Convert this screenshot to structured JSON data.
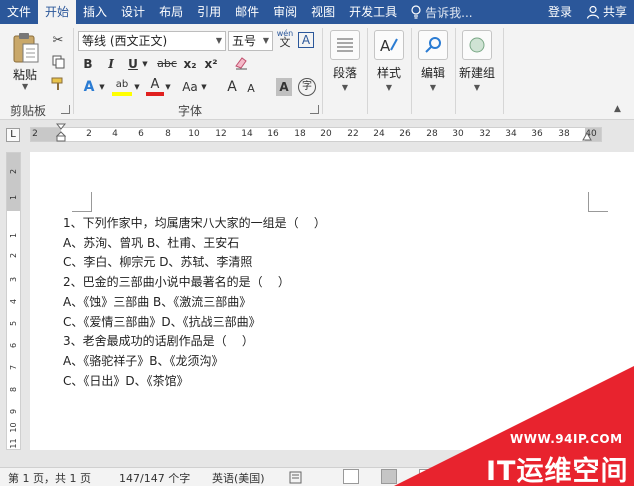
{
  "tabs": [
    "文件",
    "开始",
    "插入",
    "设计",
    "布局",
    "引用",
    "邮件",
    "审阅",
    "视图",
    "开发工具"
  ],
  "active_tab": "开始",
  "tell_me": "告诉我...",
  "signin": "登录",
  "share": "共享",
  "ribbon": {
    "paste_label": "粘贴",
    "clipboard_group": "剪贴板",
    "font_group": "字体",
    "font_name": "等线 (西文正文)",
    "font_size": "五号",
    "wen_glyph": "wén",
    "wen_char": "文",
    "bold": "B",
    "italic": "I",
    "underline": "U",
    "strikethrough": "abc",
    "subscript": "x₂",
    "superscript": "x²",
    "text_effect": "A",
    "highlight": "ab",
    "font_color": "A",
    "change_case": "Aa",
    "grow": "A",
    "shrink": "A",
    "char_shading": "A",
    "enclose": "字",
    "paragraph_label": "段落",
    "styles_label": "样式",
    "editing_label": "编辑",
    "new_group_label": "新建组"
  },
  "ruler_ticks": [
    "2",
    "2",
    "4",
    "6",
    "8",
    "10",
    "12",
    "14",
    "16",
    "18",
    "20",
    "22",
    "24",
    "26",
    "28",
    "30",
    "32",
    "34",
    "36",
    "38",
    "40"
  ],
  "vruler_ticks": [
    "2",
    "1",
    "1",
    "2",
    "3",
    "4",
    "5",
    "6",
    "7",
    "8",
    "9",
    "10",
    "11"
  ],
  "doc_lines": [
    "1、下列作家中，均属唐宋八大家的一组是（    ）",
    "A、苏洵、曾巩 B、杜甫、王安石",
    "C、李白、柳宗元 D、苏轼、李清照",
    "2、巴金的三部曲小说中最著名的是（    ）",
    "A、《蚀》三部曲 B、《激流三部曲》",
    "C、《爱情三部曲》D、《抗战三部曲》",
    "3、老舍最成功的话剧作品是（    ）",
    "A、《骆驼祥子》B、《龙须沟》",
    "C、《日出》D、《茶馆》"
  ],
  "status": {
    "page": "第 1 页，共 1 页",
    "words": "147/147 个字",
    "language": "英语(美国)"
  },
  "watermark": {
    "url": "WWW.94IP.COM",
    "brand": "IT运维空间"
  },
  "colors": {
    "accent": "#2b579a",
    "watermark_red": "#e8232e"
  }
}
